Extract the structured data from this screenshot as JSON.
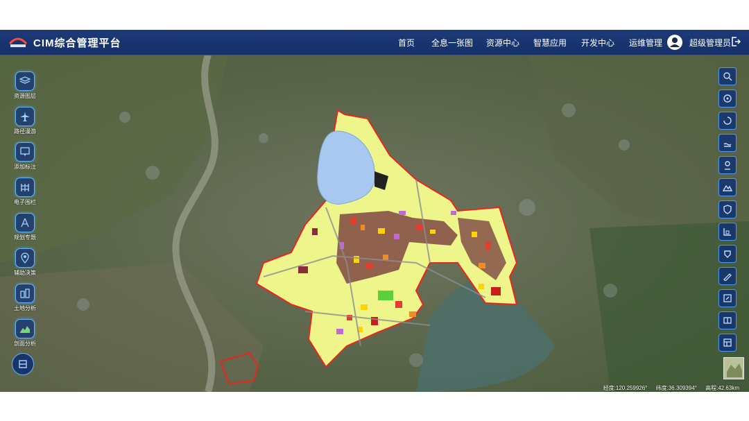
{
  "app": {
    "title": "CIM综合管理平台"
  },
  "nav": [
    {
      "label": "首页"
    },
    {
      "label": "全息一张图"
    },
    {
      "label": "资源中心"
    },
    {
      "label": "智慧应用"
    },
    {
      "label": "开发中心"
    },
    {
      "label": "运维管理"
    }
  ],
  "user": {
    "name": "超级管理员"
  },
  "left_tools": [
    {
      "label": "资源图层",
      "icon": "layers-icon"
    },
    {
      "label": "路径漫游",
      "icon": "plane-icon"
    },
    {
      "label": "添加标注",
      "icon": "annotation-icon"
    },
    {
      "label": "电子围栏",
      "icon": "fence-icon"
    },
    {
      "label": "规划专题",
      "icon": "compass-icon"
    },
    {
      "label": "辅助决策",
      "icon": "location-icon"
    },
    {
      "label": "土地分析",
      "icon": "buildings-icon"
    },
    {
      "label": "剖面分析",
      "icon": "profile-icon"
    }
  ],
  "right_tools": [
    {
      "icon": "search-icon"
    },
    {
      "icon": "query-icon"
    },
    {
      "icon": "rotate-icon"
    },
    {
      "icon": "flood-icon"
    },
    {
      "icon": "pin-icon"
    },
    {
      "icon": "terrain-icon"
    },
    {
      "icon": "shield-icon"
    },
    {
      "icon": "measure-icon"
    },
    {
      "icon": "shadow-icon"
    },
    {
      "icon": "draw-icon"
    },
    {
      "icon": "edit-icon"
    },
    {
      "icon": "split-screen-icon"
    },
    {
      "icon": "layout-icon"
    }
  ],
  "status": {
    "longitude": "经度:120.259926°",
    "latitude": "纬度:36.309394°",
    "altitude": "高程:42.63km"
  },
  "colors": {
    "header": "#1d3a78",
    "accent": "#4a9af0",
    "boundary": "#e8261f",
    "zone_yellow": "#eef58a",
    "zone_brown": "#8a5a4a",
    "water": "#a9c8f0"
  }
}
